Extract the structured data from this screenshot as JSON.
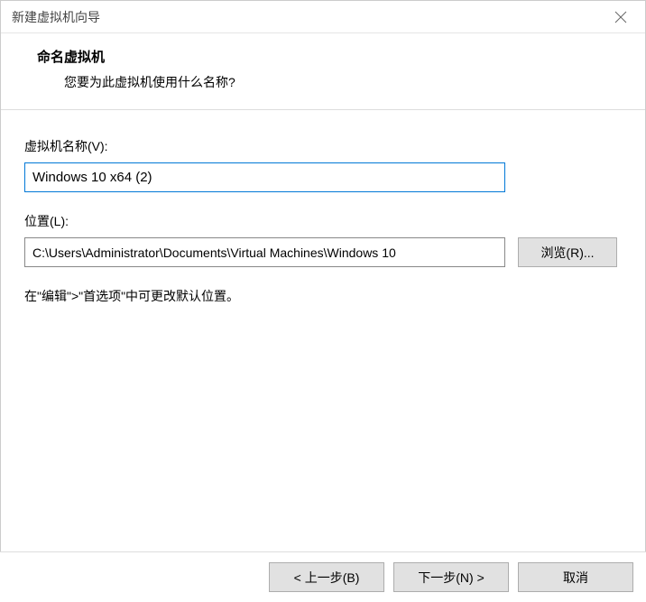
{
  "titlebar": {
    "title": "新建虚拟机向导"
  },
  "header": {
    "heading": "命名虚拟机",
    "subheading": "您要为此虚拟机使用什么名称?"
  },
  "fields": {
    "name_label": "虚拟机名称(V):",
    "name_value": "Windows 10 x64 (2)",
    "location_label": "位置(L):",
    "location_value": "C:\\Users\\Administrator\\Documents\\Virtual Machines\\Windows 10",
    "browse_label": "浏览(R)..."
  },
  "hint": "在\"编辑\">\"首选项\"中可更改默认位置。",
  "footer": {
    "back_label": "< 上一步(B)",
    "next_label": "下一步(N) >",
    "cancel_label": "取消"
  }
}
